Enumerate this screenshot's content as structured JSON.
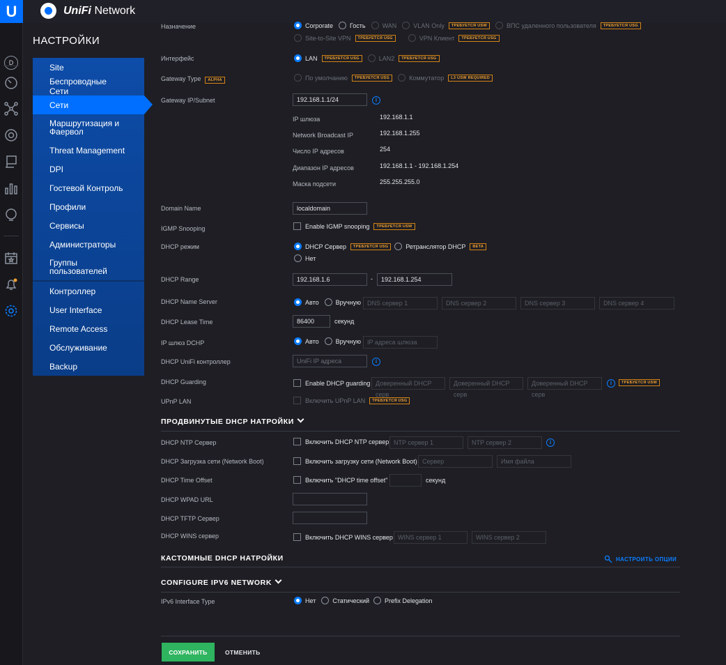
{
  "app": {
    "logo": "U",
    "brand_prefix": "UniFi",
    "brand_suffix": " Network",
    "avatar": "D"
  },
  "rail_icons": [
    "dashboard-icon",
    "stats-icon",
    "topology-icon",
    "devices-icon",
    "clients-icon",
    "insights-icon",
    "events-icon",
    "alerts-icon",
    "settings-icon"
  ],
  "sidebar": {
    "title": "НАСТРОЙКИ",
    "items": [
      "Site",
      "Беспроводные Сети",
      "Сети",
      "Маршрутизация и Фаервол",
      "Threat Management",
      "DPI",
      "Гостевой Контроль",
      "Профили",
      "Сервисы",
      "Администраторы",
      "Группы пользователей",
      "Контроллер",
      "User Interface",
      "Remote Access",
      "Обслуживание",
      "Backup"
    ],
    "active": "Сети"
  },
  "badges": {
    "usg": "ТРЕБУЕТСЯ USG",
    "usw": "ТРЕБУЕТСЯ USW",
    "alpha": "ALPHA",
    "l3": "L3 USW REQUIRED",
    "beta": "BETA"
  },
  "form": {
    "purpose": {
      "label": "Назначение",
      "options": [
        "Corporate",
        "Гость",
        "WAN",
        "VLAN Only",
        "ВПС удаленного пользователя",
        "Site-to-Site VPN",
        "VPN Клиент"
      ]
    },
    "interface": {
      "label": "Интерфейс",
      "options": [
        "LAN",
        "LAN2"
      ]
    },
    "gateway_type": {
      "label": "Gateway Type",
      "options": [
        "По умолчанию",
        "Коммутатор"
      ]
    },
    "gateway_subnet": {
      "label": "Gateway IP/Subnet",
      "value": "192.168.1.1/24"
    },
    "info": [
      {
        "k": "IP шлюза",
        "v": "192.168.1.1"
      },
      {
        "k": "Network Broadcast IP",
        "v": "192.168.1.255"
      },
      {
        "k": "Число IP адресов",
        "v": "254"
      },
      {
        "k": "Диапазон IP адресов",
        "v": "192.168.1.1 - 192.168.1.254"
      },
      {
        "k": "Маска подсети",
        "v": "255.255.255.0"
      }
    ],
    "domain": {
      "label": "Domain Name",
      "value": "localdomain"
    },
    "igmp": {
      "label": "IGMP Snooping",
      "option": "Enable IGMP snooping"
    },
    "dhcp_mode": {
      "label": "DHCP режим",
      "options": [
        "DHCP Сервер",
        "Ретранслятор DHCP",
        "Нет"
      ]
    },
    "dhcp_range": {
      "label": "DHCP Range",
      "start": "192.168.1.6",
      "sep": "-",
      "end": "192.168.1.254"
    },
    "name_server": {
      "label": "DHCP Name Server",
      "options": [
        "Авто",
        "Вручную"
      ],
      "placeholders": [
        "DNS сервер 1",
        "DNS сервер 2",
        "DNS сервер 3",
        "DNS сервер 4"
      ]
    },
    "lease": {
      "label": "DHCP Lease Time",
      "value": "86400",
      "unit": "секунд"
    },
    "gateway_dhcp": {
      "label": "IP шлюз DCHP",
      "options": [
        "Авто",
        "Вручную"
      ],
      "placeholder": "IP адреса шлюза"
    },
    "unifi_ctrl": {
      "label": "DHCP UniFi контроллер",
      "placeholder": "UniFi IP адреса"
    },
    "guarding": {
      "label": "DHCP Guarding",
      "option": "Enable DHCP guarding",
      "placeholders": [
        "Доверенный DHCP серв",
        "Доверенный DHCP серв",
        "Доверенный DHCP серв"
      ]
    },
    "upnp": {
      "label": "UPnP LAN",
      "option": "Включить UPnP LAN"
    }
  },
  "advanced": {
    "title": "ПРОДВИНУТЫЕ DHCP НАТРОЙКИ",
    "ntp": {
      "label": "DHCP NTP Сервер",
      "option": "Включить DHCP NTP сервер",
      "placeholders": [
        "NTP сервер 1",
        "NTP сервер 2"
      ]
    },
    "boot": {
      "label": "DHCP Загрузка сети (Network Boot)",
      "option": "Включить загрузку сети (Network Boot)",
      "placeholders": [
        "Сервер",
        "Имя файла"
      ]
    },
    "offset": {
      "label": "DHCP Time Offset",
      "option": "Включить \"DHCP time offset\"",
      "unit": "секунд"
    },
    "wpad": {
      "label": "DHCP WPAD URL"
    },
    "tftp": {
      "label": "DHCP TFTP Сервер"
    },
    "wins": {
      "label": "DHCP WINS сервер",
      "option": "Включить DHCP WINS сервер",
      "placeholders": [
        "WINS сервер 1",
        "WINS сервер 2"
      ]
    }
  },
  "custom": {
    "title": "КАСТОМНЫЕ DHCP НАТРОЙКИ",
    "action": "НАСТРОИТЬ ОПЦИИ"
  },
  "ipv6": {
    "title": "CONFIGURE IPV6 NETWORK",
    "label": "IPv6 Interface Type",
    "options": [
      "Нет",
      "Статический",
      "Prefix Delegation"
    ]
  },
  "actions": {
    "save": "СОХРАНИТЬ",
    "cancel": "ОТМЕНИТЬ"
  }
}
